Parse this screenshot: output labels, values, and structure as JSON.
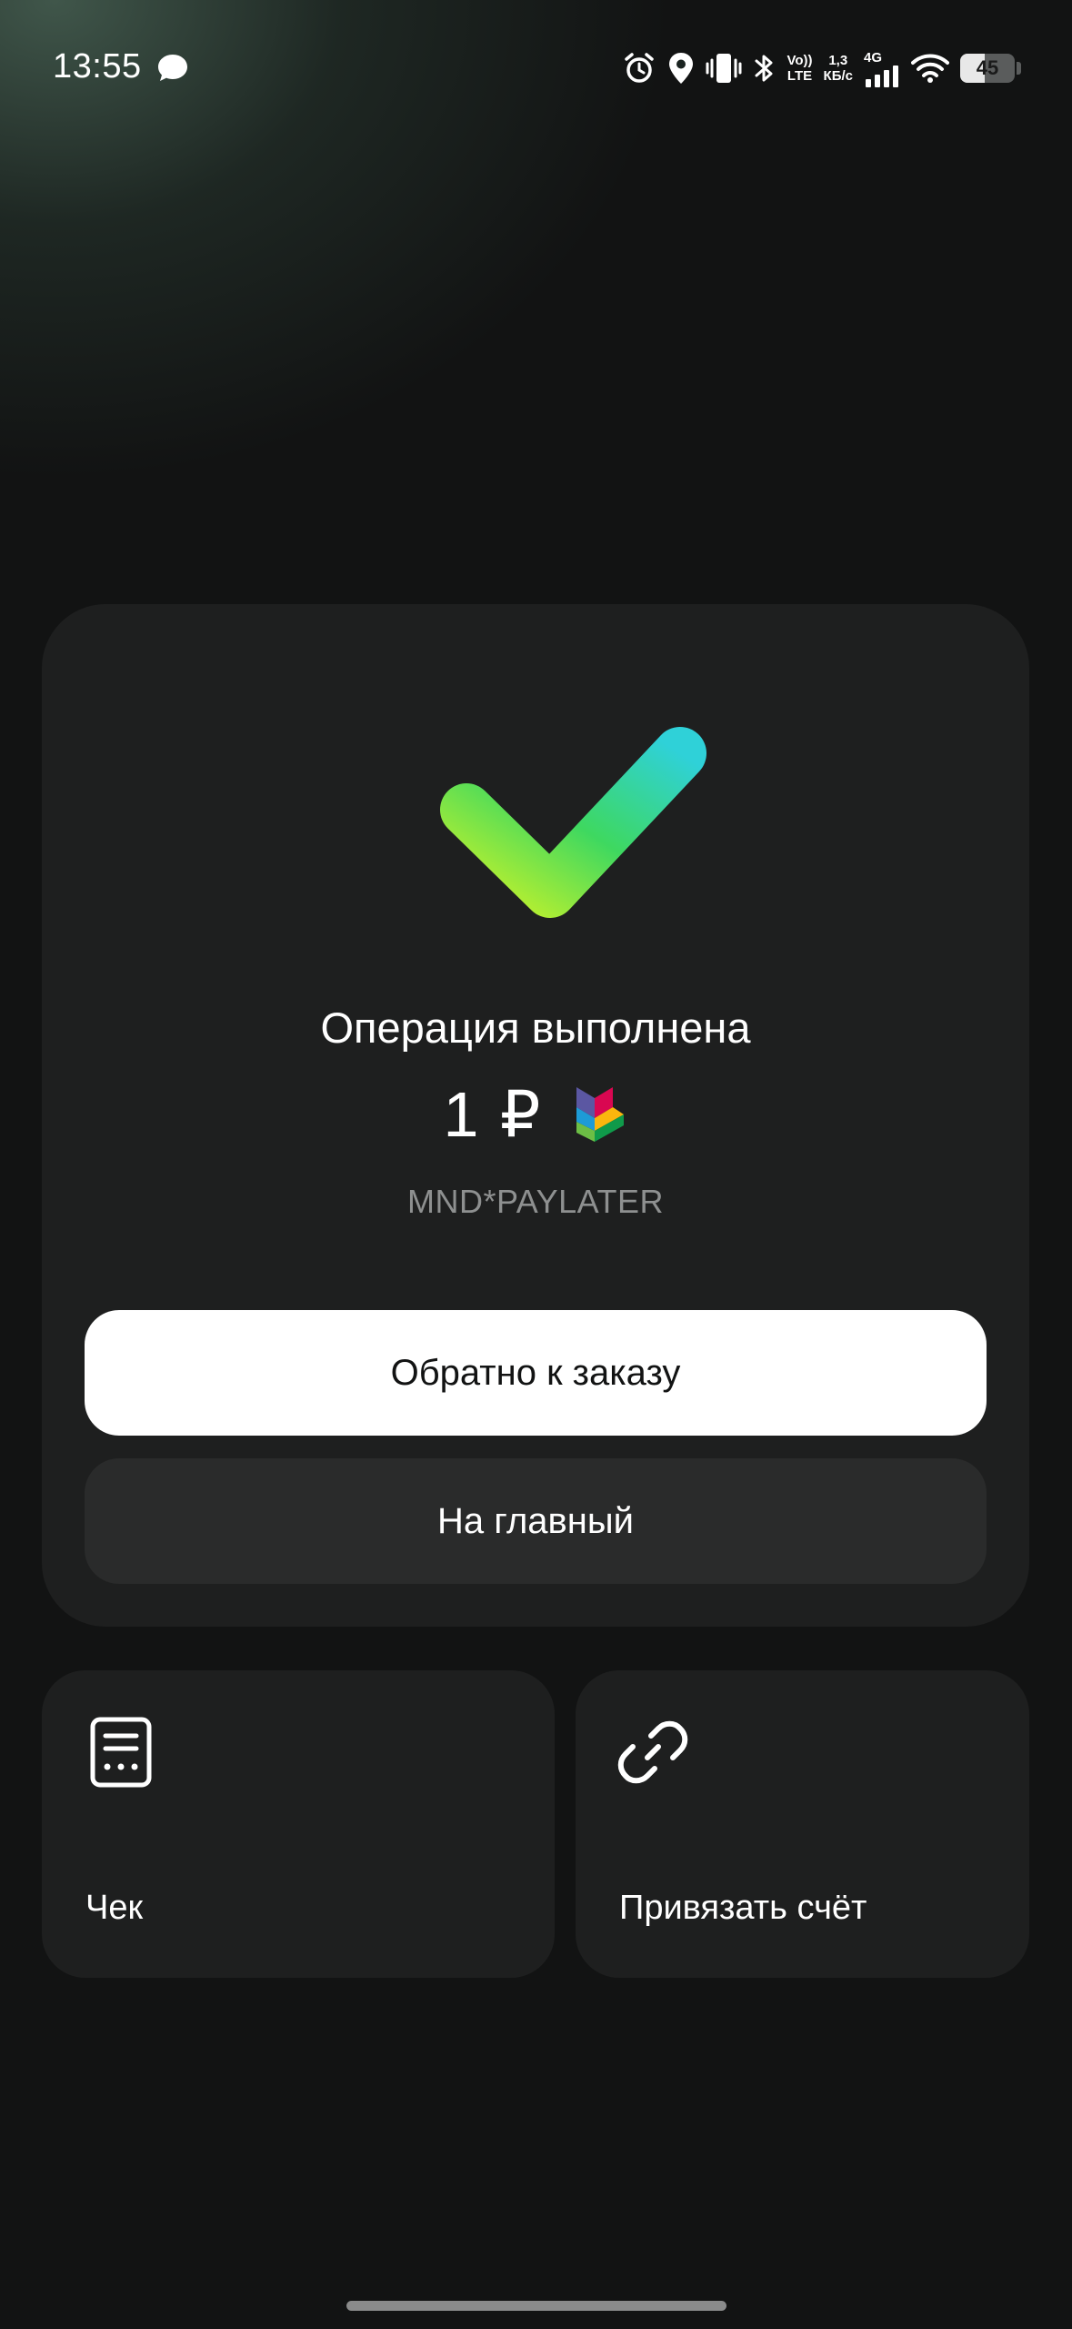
{
  "status_bar": {
    "time": "13:55",
    "volte_line1": "Vo))",
    "volte_line2": "LTE",
    "speed_line1": "1,3",
    "speed_line2": "КБ/с",
    "network": "4G",
    "battery": "45"
  },
  "result": {
    "title": "Операция выполнена",
    "amount": "1 ₽",
    "merchant": "MND*PAYLATER"
  },
  "buttons": {
    "primary_label": "Обратно к заказу",
    "secondary_label": "На главный"
  },
  "tiles": {
    "receipt_label": "Чек",
    "link_account_label": "Привязать счёт"
  },
  "colors": {
    "background": "#121313",
    "card": "#1e1f1f",
    "secondary_button": "#2a2b2b",
    "check_gradient_start": "#c6f22a",
    "check_gradient_end": "#2fd1d8",
    "merchant_text": "#8e9090"
  },
  "icons": {
    "message": "message-bubble-icon",
    "alarm": "alarm-icon",
    "location": "location-pin-icon",
    "vibrate": "vibrate-icon",
    "bluetooth": "bluetooth-icon",
    "signal": "signal-bars-icon",
    "wifi": "wifi-icon",
    "success": "checkmark-icon",
    "merchant": "sbp-logo-icon",
    "receipt": "receipt-icon",
    "link": "link-icon"
  }
}
